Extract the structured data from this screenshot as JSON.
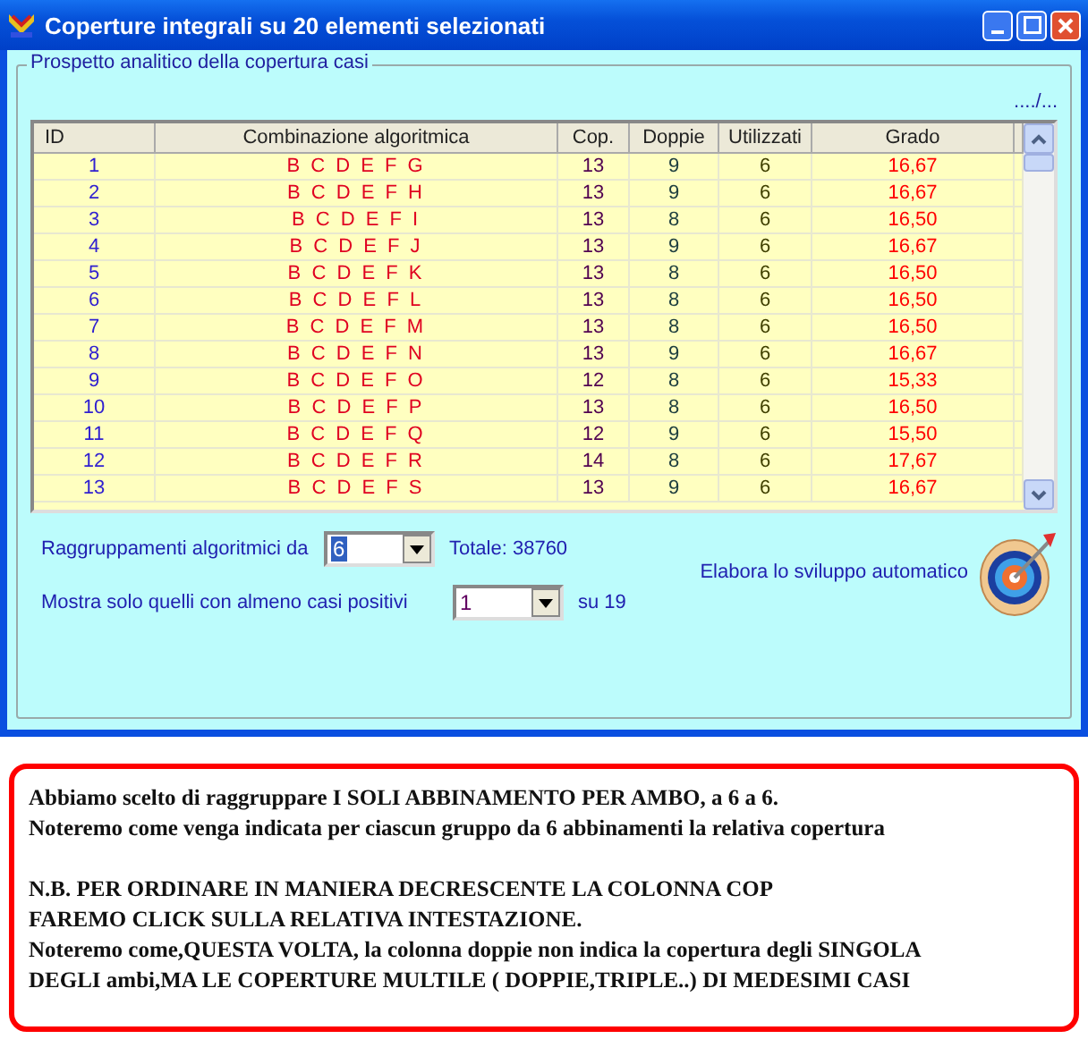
{
  "window": {
    "title": "Coperture integrali su 20 elementi selezionati"
  },
  "group": {
    "title": "Prospetto analitico della copertura casi",
    "more": "..../..."
  },
  "table": {
    "columns": [
      "ID",
      "Combinazione algoritmica",
      "Cop.",
      "Doppie",
      "Utilizzati",
      "Grado"
    ],
    "rows": [
      {
        "id": "1",
        "comb": "B C D E F G",
        "cop": "13",
        "doppie": "9",
        "utilizzati": "6",
        "grado": "16,67"
      },
      {
        "id": "2",
        "comb": "B C D E F H",
        "cop": "13",
        "doppie": "9",
        "utilizzati": "6",
        "grado": "16,67"
      },
      {
        "id": "3",
        "comb": "B C D E F I",
        "cop": "13",
        "doppie": "8",
        "utilizzati": "6",
        "grado": "16,50"
      },
      {
        "id": "4",
        "comb": "B C D E F J",
        "cop": "13",
        "doppie": "9",
        "utilizzati": "6",
        "grado": "16,67"
      },
      {
        "id": "5",
        "comb": "B C D E F K",
        "cop": "13",
        "doppie": "8",
        "utilizzati": "6",
        "grado": "16,50"
      },
      {
        "id": "6",
        "comb": "B C D E F L",
        "cop": "13",
        "doppie": "8",
        "utilizzati": "6",
        "grado": "16,50"
      },
      {
        "id": "7",
        "comb": "B C D E F M",
        "cop": "13",
        "doppie": "8",
        "utilizzati": "6",
        "grado": "16,50"
      },
      {
        "id": "8",
        "comb": "B C D E F N",
        "cop": "13",
        "doppie": "9",
        "utilizzati": "6",
        "grado": "16,67"
      },
      {
        "id": "9",
        "comb": "B C D E F O",
        "cop": "12",
        "doppie": "8",
        "utilizzati": "6",
        "grado": "15,33"
      },
      {
        "id": "10",
        "comb": "B C D E F P",
        "cop": "13",
        "doppie": "8",
        "utilizzati": "6",
        "grado": "16,50"
      },
      {
        "id": "11",
        "comb": "B C D E F Q",
        "cop": "12",
        "doppie": "9",
        "utilizzati": "6",
        "grado": "15,50"
      },
      {
        "id": "12",
        "comb": "B C D E F R",
        "cop": "14",
        "doppie": "8",
        "utilizzati": "6",
        "grado": "17,67"
      },
      {
        "id": "13",
        "comb": "B C D E F S",
        "cop": "13",
        "doppie": "9",
        "utilizzati": "6",
        "grado": "16,67"
      }
    ]
  },
  "controls": {
    "group_label": "Raggruppamenti algoritmici da",
    "group_value": "6",
    "total": "Totale: 38760",
    "filter_label": "Mostra solo quelli con almeno casi positivi",
    "filter_value": "1",
    "filter_suffix": "su 19",
    "action_label": "Elabora lo sviluppo automatico"
  },
  "note": [
    [
      "Abbiamo scelto di raggruppare I SOLI ABBINAMENTO PER AMBO, a 6 a 6.",
      "Noteremo come venga indicata per ciascun gruppo da 6 abbinamenti la relativa copertura"
    ],
    [
      "N.B. PER ORDINARE IN MANIERA DECRESCENTE LA COLONNA COP",
      "FAREMO CLICK SULLA RELATIVA INTESTAZIONE.",
      "Noteremo come,QUESTA VOLTA, la colonna doppie non indica la copertura degli SINGOLA",
      "DEGLI ambi,MA LE COPERTURE MULTILE ( DOPPIE,TRIPLE..) DI MEDESIMI CASI"
    ]
  ]
}
